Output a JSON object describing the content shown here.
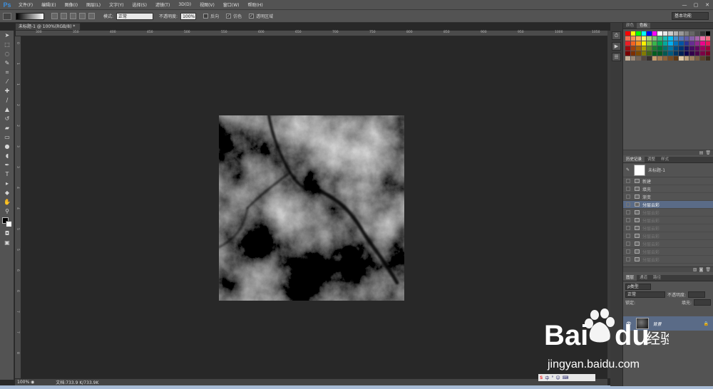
{
  "app": {
    "logo": "Ps"
  },
  "menubar": {
    "items": [
      "文件(F)",
      "编辑(E)",
      "图像(I)",
      "图层(L)",
      "文字(Y)",
      "选择(S)",
      "滤镜(T)",
      "3D(D)",
      "视图(V)",
      "窗口(W)",
      "帮助(H)"
    ],
    "window_controls": [
      "—",
      "▢",
      "✕"
    ]
  },
  "options_bar": {
    "mode_label": "模式:",
    "mode_value": "正常",
    "opacity_label": "不透明度:",
    "opacity_value": "100%",
    "checkbox_reverse": "反向",
    "checkbox_dither": "仿色",
    "checkbox_transparency": "透明区域",
    "workspace": "基本功能"
  },
  "document": {
    "tab_title": "未标题-1 @ 100%(RGB/8) *",
    "zoom": "100%",
    "doc_size": "文档:733.9 K/733.9K"
  },
  "ruler": {
    "h_ticks": [
      "300",
      "350",
      "400",
      "450",
      "500",
      "550",
      "600",
      "650",
      "700",
      "750",
      "800",
      "850",
      "900",
      "950",
      "1000",
      "1050"
    ],
    "v_ticks": [
      "0",
      "1",
      "1",
      "2",
      "2",
      "3",
      "3",
      "4",
      "4",
      "5",
      "5",
      "6",
      "6",
      "7",
      "7",
      "8"
    ]
  },
  "swatches_panel": {
    "tabs": [
      "颜色",
      "色板"
    ],
    "colors": [
      "#ff0000",
      "#ffff00",
      "#00ff00",
      "#00ffff",
      "#0000ff",
      "#ff00ff",
      "#ffffff",
      "#e6e6e6",
      "#cccccc",
      "#b3b3b3",
      "#999999",
      "#808080",
      "#666666",
      "#4d4d4d",
      "#333333",
      "#000000",
      "#f26c4f",
      "#f68e56",
      "#fbaf5c",
      "#fff467",
      "#acd372",
      "#7cc576",
      "#3bb878",
      "#1abbb4",
      "#00bff3",
      "#438ccb",
      "#5574b9",
      "#605ca9",
      "#855fa8",
      "#a763a9",
      "#ef6ea8",
      "#f16d7e",
      "#ed1c24",
      "#f26522",
      "#f7941d",
      "#fff200",
      "#8dc63f",
      "#39b54a",
      "#00a651",
      "#00a99d",
      "#00aeef",
      "#0072bc",
      "#0054a5",
      "#2e3192",
      "#662d91",
      "#92278f",
      "#ec008c",
      "#ed145b",
      "#9e0b0f",
      "#a0410d",
      "#a36209",
      "#aba000",
      "#598527",
      "#1a7b30",
      "#007236",
      "#00746b",
      "#0076a3",
      "#004b80",
      "#003471",
      "#1b1464",
      "#440e62",
      "#630460",
      "#9e005d",
      "#9e0039",
      "#790000",
      "#7b2e00",
      "#7d4900",
      "#827b00",
      "#406618",
      "#005e20",
      "#005826",
      "#005952",
      "#005b7f",
      "#003663",
      "#002157",
      "#0d004c",
      "#32004b",
      "#4b0049",
      "#7b0046",
      "#7a0026",
      "#c7b299",
      "#998675",
      "#736357",
      "#534741",
      "#37302d",
      "#c69c6d",
      "#a67c52",
      "#8c6239",
      "#754c24",
      "#603913",
      "#e0c9a6",
      "#bfa37f",
      "#9c7f5f",
      "#7a5f44",
      "#5a432c",
      "#3d2b1a"
    ]
  },
  "history_panel": {
    "tabs": [
      "历史记录",
      "调整",
      "样式"
    ],
    "snapshot_label": "未标题-1",
    "items": [
      {
        "label": "新建",
        "state": "normal"
      },
      {
        "label": "填充",
        "state": "normal"
      },
      {
        "label": "渐变",
        "state": "normal"
      },
      {
        "label": "分层云彩",
        "state": "selected"
      },
      {
        "label": "分层云彩",
        "state": "disabled"
      },
      {
        "label": "分层云彩",
        "state": "disabled"
      },
      {
        "label": "分层云彩",
        "state": "disabled"
      },
      {
        "label": "分层云彩",
        "state": "disabled"
      },
      {
        "label": "分层云彩",
        "state": "disabled"
      },
      {
        "label": "分层云彩",
        "state": "disabled"
      },
      {
        "label": "分层云彩",
        "state": "disabled"
      }
    ]
  },
  "layers_panel": {
    "tabs": [
      "图层",
      "通道",
      "路径"
    ],
    "filter_label": "ρ类型",
    "blend_mode": "正常",
    "opacity_label": "不透明度:",
    "lock_label": "锁定:",
    "fill_label": "填充:",
    "layer_name": "背景"
  },
  "watermark": {
    "brand": "Bai",
    "brand_end": "du",
    "brand_suffix": "经验",
    "url": "jingyan.baidu.com",
    "ime": "中"
  },
  "icons": {
    "tools": [
      "move-icon",
      "marquee-icon",
      "lasso-icon",
      "quick-select-icon",
      "crop-icon",
      "eyedropper-icon",
      "healing-icon",
      "brush-icon",
      "stamp-icon",
      "history-brush-icon",
      "eraser-icon",
      "gradient-icon",
      "blur-icon",
      "dodge-icon",
      "pen-icon",
      "type-icon",
      "path-select-icon",
      "shape-icon",
      "hand-icon",
      "zoom-icon"
    ]
  }
}
